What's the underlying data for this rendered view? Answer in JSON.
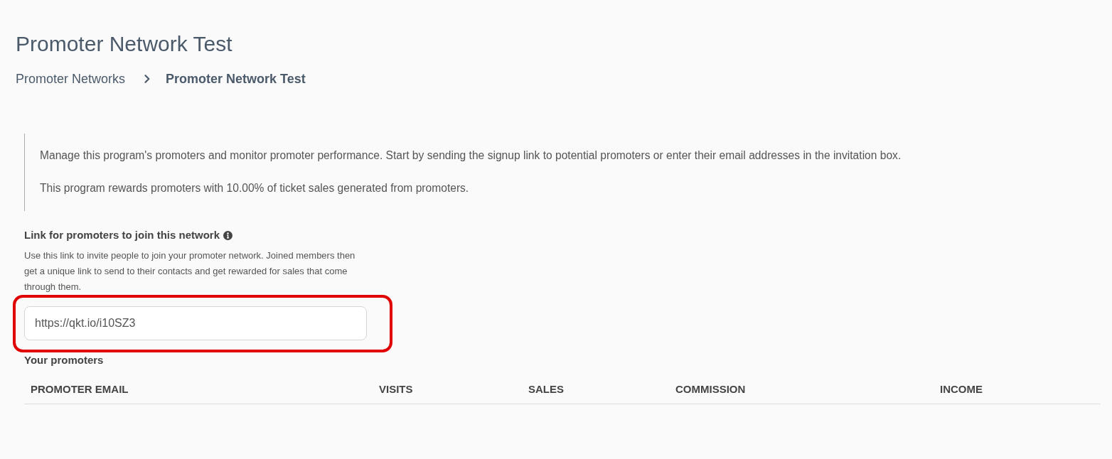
{
  "page_title": "Promoter Network Test",
  "breadcrumb": [
    {
      "label": "Promoter Networks",
      "current": false
    },
    {
      "label": "Promoter Network Test",
      "current": true
    }
  ],
  "intro": [
    "Manage this program's promoters and monitor promoter performance. Start by sending the signup link to potential promoters or enter their email addresses in the invitation box.",
    "This program rewards promoters with 10.00% of ticket sales generated from promoters."
  ],
  "join_link": {
    "heading": "Link for promoters to join this network",
    "description": "Use this link to invite people to join your promoter network. Joined members then get a unique link to send to their contacts and get rewarded for sales that come through them.",
    "value": "https://qkt.io/i10SZ3",
    "highlighted": true
  },
  "promoters": {
    "heading": "Your promoters",
    "columns": [
      "PROMOTER EMAIL",
      "VISITS",
      "SALES",
      "COMMISSION",
      "INCOME"
    ]
  }
}
